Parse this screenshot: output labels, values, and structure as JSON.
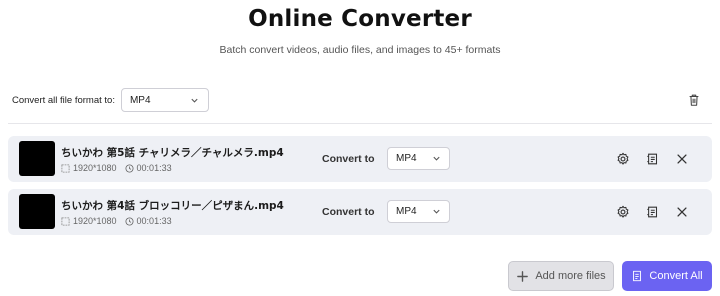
{
  "header": {
    "title": "Online Converter",
    "subtitle": "Batch convert videos, audio files, and images to 45+ formats"
  },
  "global": {
    "label": "Convert all file format to:",
    "format": "MP4"
  },
  "files": [
    {
      "name": "ちいかわ 第5話 チャリメラ／チャルメラ.mp4",
      "resolution": "1920*1080",
      "duration": "00:01:33",
      "convert_label": "Convert to",
      "format": "MP4"
    },
    {
      "name": "ちいかわ 第4話 ブロッコリー／ピザまん.mp4",
      "resolution": "1920*1080",
      "duration": "00:01:33",
      "convert_label": "Convert to",
      "format": "MP4"
    }
  ],
  "actions": {
    "add_more": "Add more files",
    "convert_all": "Convert All"
  },
  "colors": {
    "accent": "#6b63f2",
    "row_bg": "#eef0f5"
  }
}
